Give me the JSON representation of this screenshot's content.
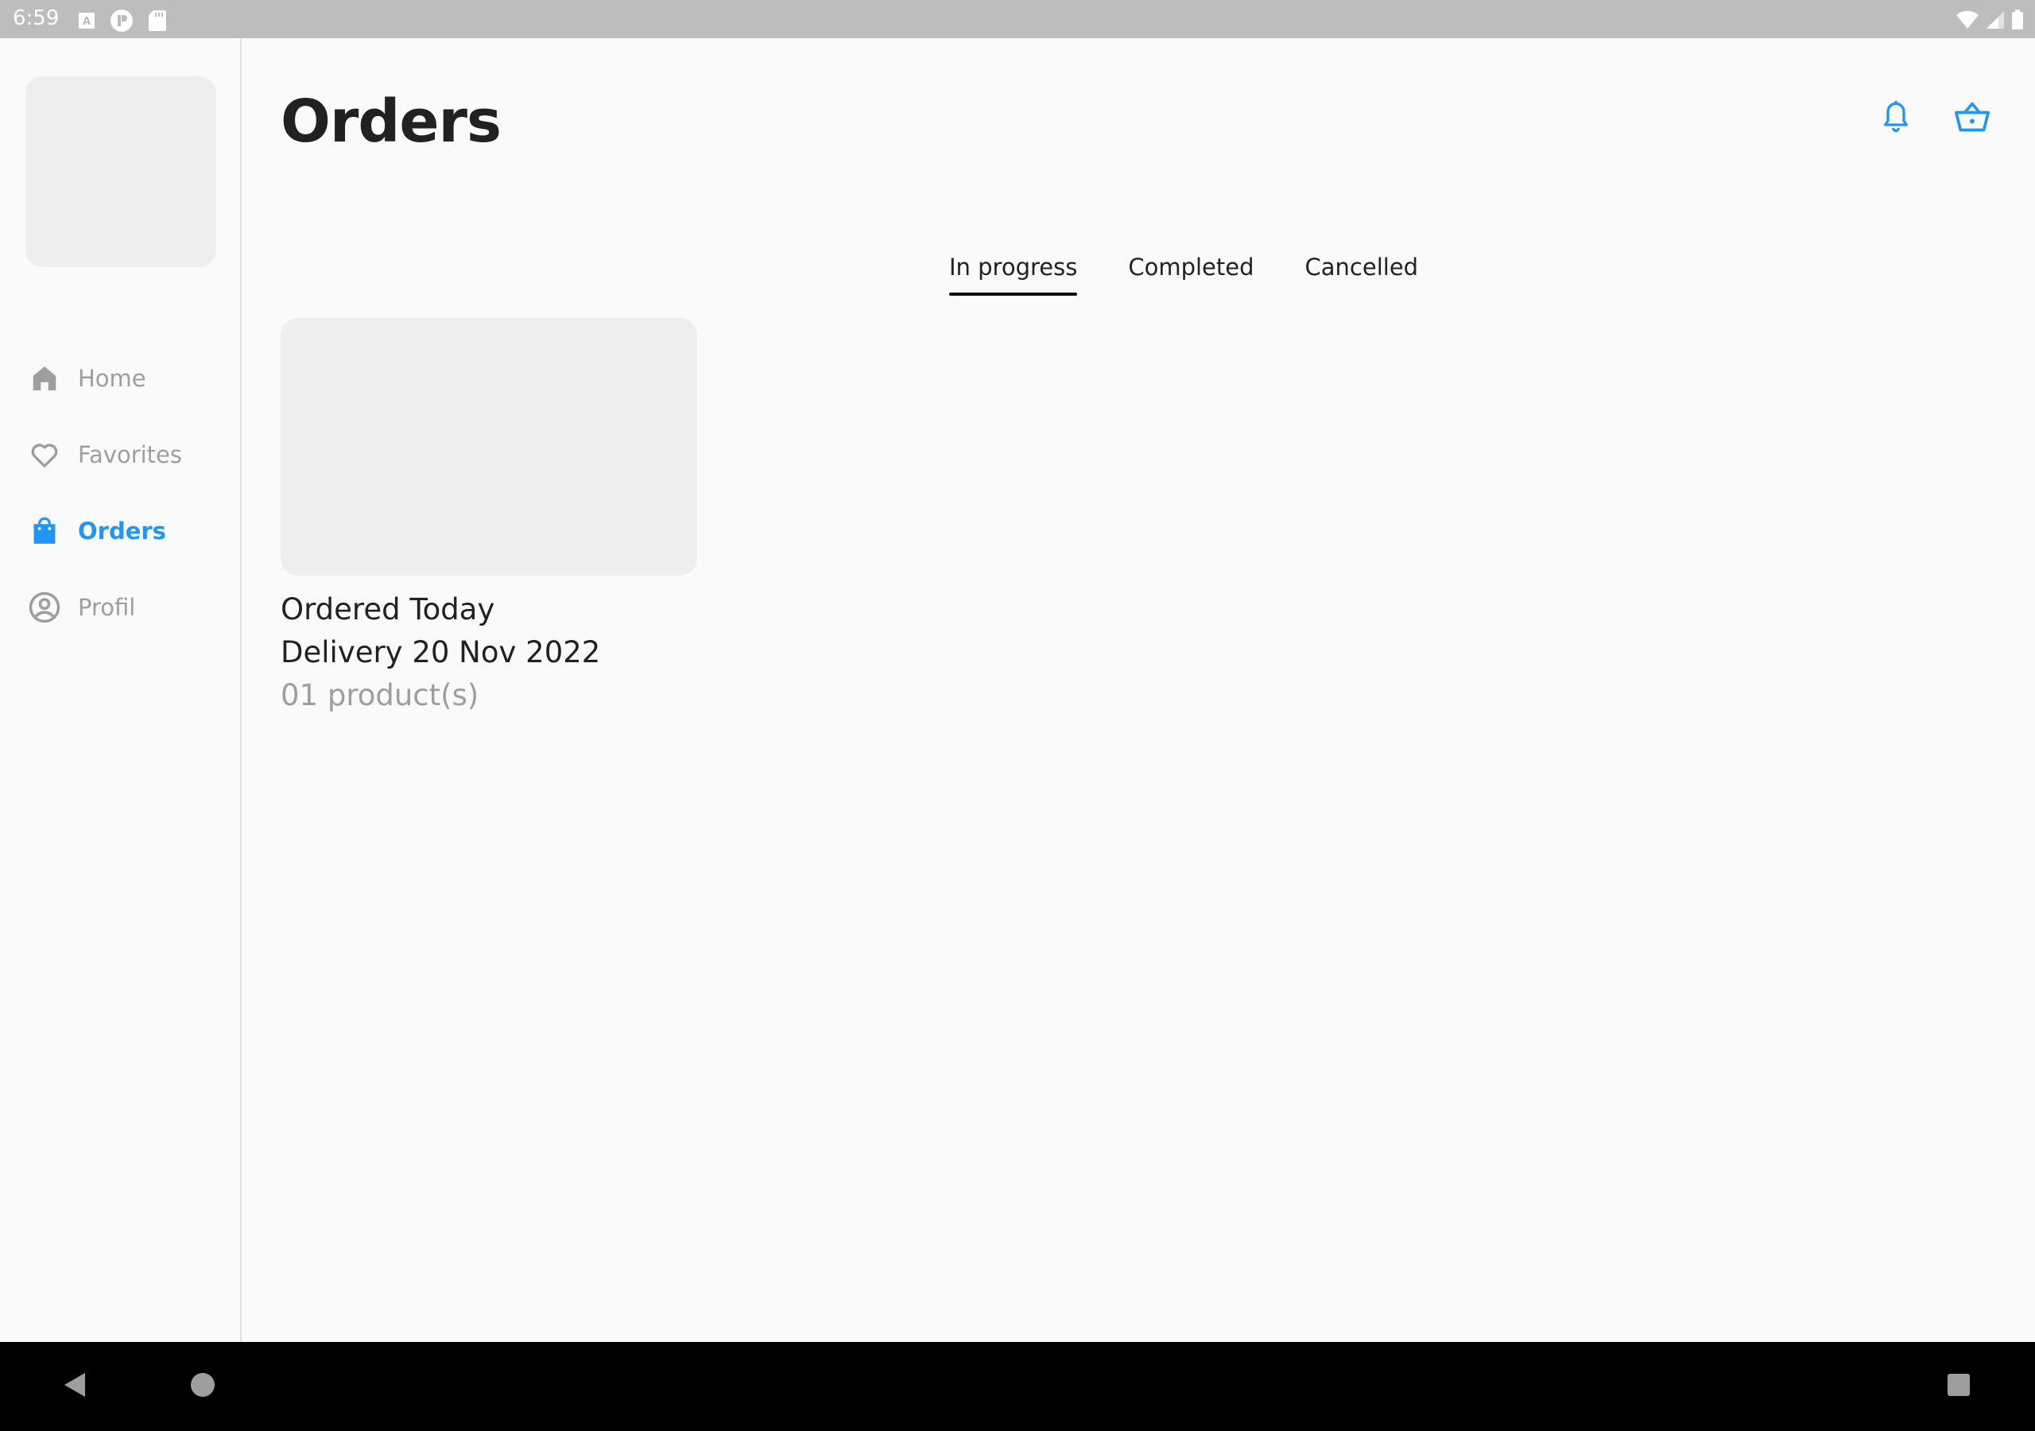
{
  "status_bar": {
    "time": "6:59"
  },
  "sidebar": {
    "items": [
      {
        "label": "Home",
        "icon": "home-icon",
        "active": false
      },
      {
        "label": "Favorites",
        "icon": "heart-icon",
        "active": false
      },
      {
        "label": "Orders",
        "icon": "shopping-bag-icon",
        "active": true
      },
      {
        "label": "Profil",
        "icon": "account-circle-icon",
        "active": false
      }
    ]
  },
  "header": {
    "title": "Orders",
    "actions": [
      "bell-icon",
      "basket-icon"
    ]
  },
  "tabs": [
    {
      "label": "In progress",
      "active": true
    },
    {
      "label": "Completed",
      "active": false
    },
    {
      "label": "Cancelled",
      "active": false
    }
  ],
  "orders": [
    {
      "ordered": "Ordered Today",
      "delivery": "Delivery 20 Nov 2022",
      "count": "01 product(s)"
    }
  ],
  "colors": {
    "accent": "#2196f3",
    "inactive": "#9e9e9e",
    "text": "#212121",
    "placeholder": "#eeeeee",
    "background": "#fafafa",
    "status_bar": "#bdbdbd"
  }
}
